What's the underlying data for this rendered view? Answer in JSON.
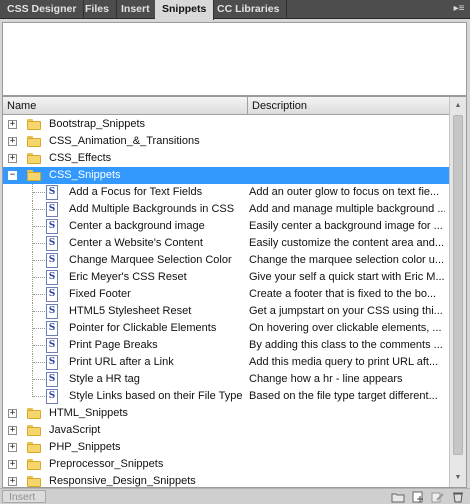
{
  "tabs": [
    {
      "label": "CSS Designer",
      "active": false
    },
    {
      "label": "Files",
      "active": false
    },
    {
      "label": "Insert",
      "active": false
    },
    {
      "label": "Snippets",
      "active": true
    },
    {
      "label": "CC Libraries",
      "active": false
    }
  ],
  "columns": {
    "name": "Name",
    "description": "Description"
  },
  "folders_before": [
    {
      "label": "Bootstrap_Snippets"
    },
    {
      "label": "CSS_Animation_&_Transitions"
    },
    {
      "label": "CSS_Effects"
    }
  ],
  "expanded_folder": {
    "label": "CSS_Snippets",
    "selected": true
  },
  "snippets": [
    {
      "name": "Add a Focus for Text Fields",
      "description": "Add an outer glow to focus on text fie..."
    },
    {
      "name": "Add Multiple Backgrounds in CSS",
      "description": "Add and manage multiple background ..."
    },
    {
      "name": "Center a background image",
      "description": "Easily center a background image for ..."
    },
    {
      "name": "Center a Website's Content",
      "description": "Easily customize the content area and..."
    },
    {
      "name": "Change Marquee Selection Color",
      "description": "Change the marquee selection color u..."
    },
    {
      "name": "Eric Meyer's CSS Reset",
      "description": "Give your self a quick start with Eric M..."
    },
    {
      "name": "Fixed Footer",
      "description": "Create a footer that is fixed to the bo..."
    },
    {
      "name": "HTML5 Stylesheet Reset",
      "description": "Get a jumpstart on your CSS using thi..."
    },
    {
      "name": "Pointer for Clickable Elements",
      "description": "On hovering over clickable elements, ..."
    },
    {
      "name": "Print Page Breaks",
      "description": "By adding this class to the comments ..."
    },
    {
      "name": "Print URL after a Link",
      "description": "Add this media query to print URL aft..."
    },
    {
      "name": "Style a HR tag",
      "description": "Change how a hr - line appears"
    },
    {
      "name": "Style Links based on their File Type",
      "description": "Based on the file type target different..."
    }
  ],
  "folders_after": [
    {
      "label": "HTML_Snippets"
    },
    {
      "label": "JavaScript"
    },
    {
      "label": "PHP_Snippets"
    },
    {
      "label": "Preprocessor_Snippets"
    },
    {
      "label": "Responsive_Design_Snippets"
    }
  ],
  "expander": {
    "collapsed": "+",
    "expanded": "−"
  },
  "snippet_glyph": "S",
  "status": {
    "insert_label": "Insert"
  },
  "toolbar_icons": [
    "new-folder-icon",
    "new-snippet-icon",
    "edit-snippet-icon",
    "delete-icon"
  ],
  "colors": {
    "selection": "#3399ff",
    "tab_bar": "#4d4d4d",
    "folder": "#f4d66c"
  }
}
